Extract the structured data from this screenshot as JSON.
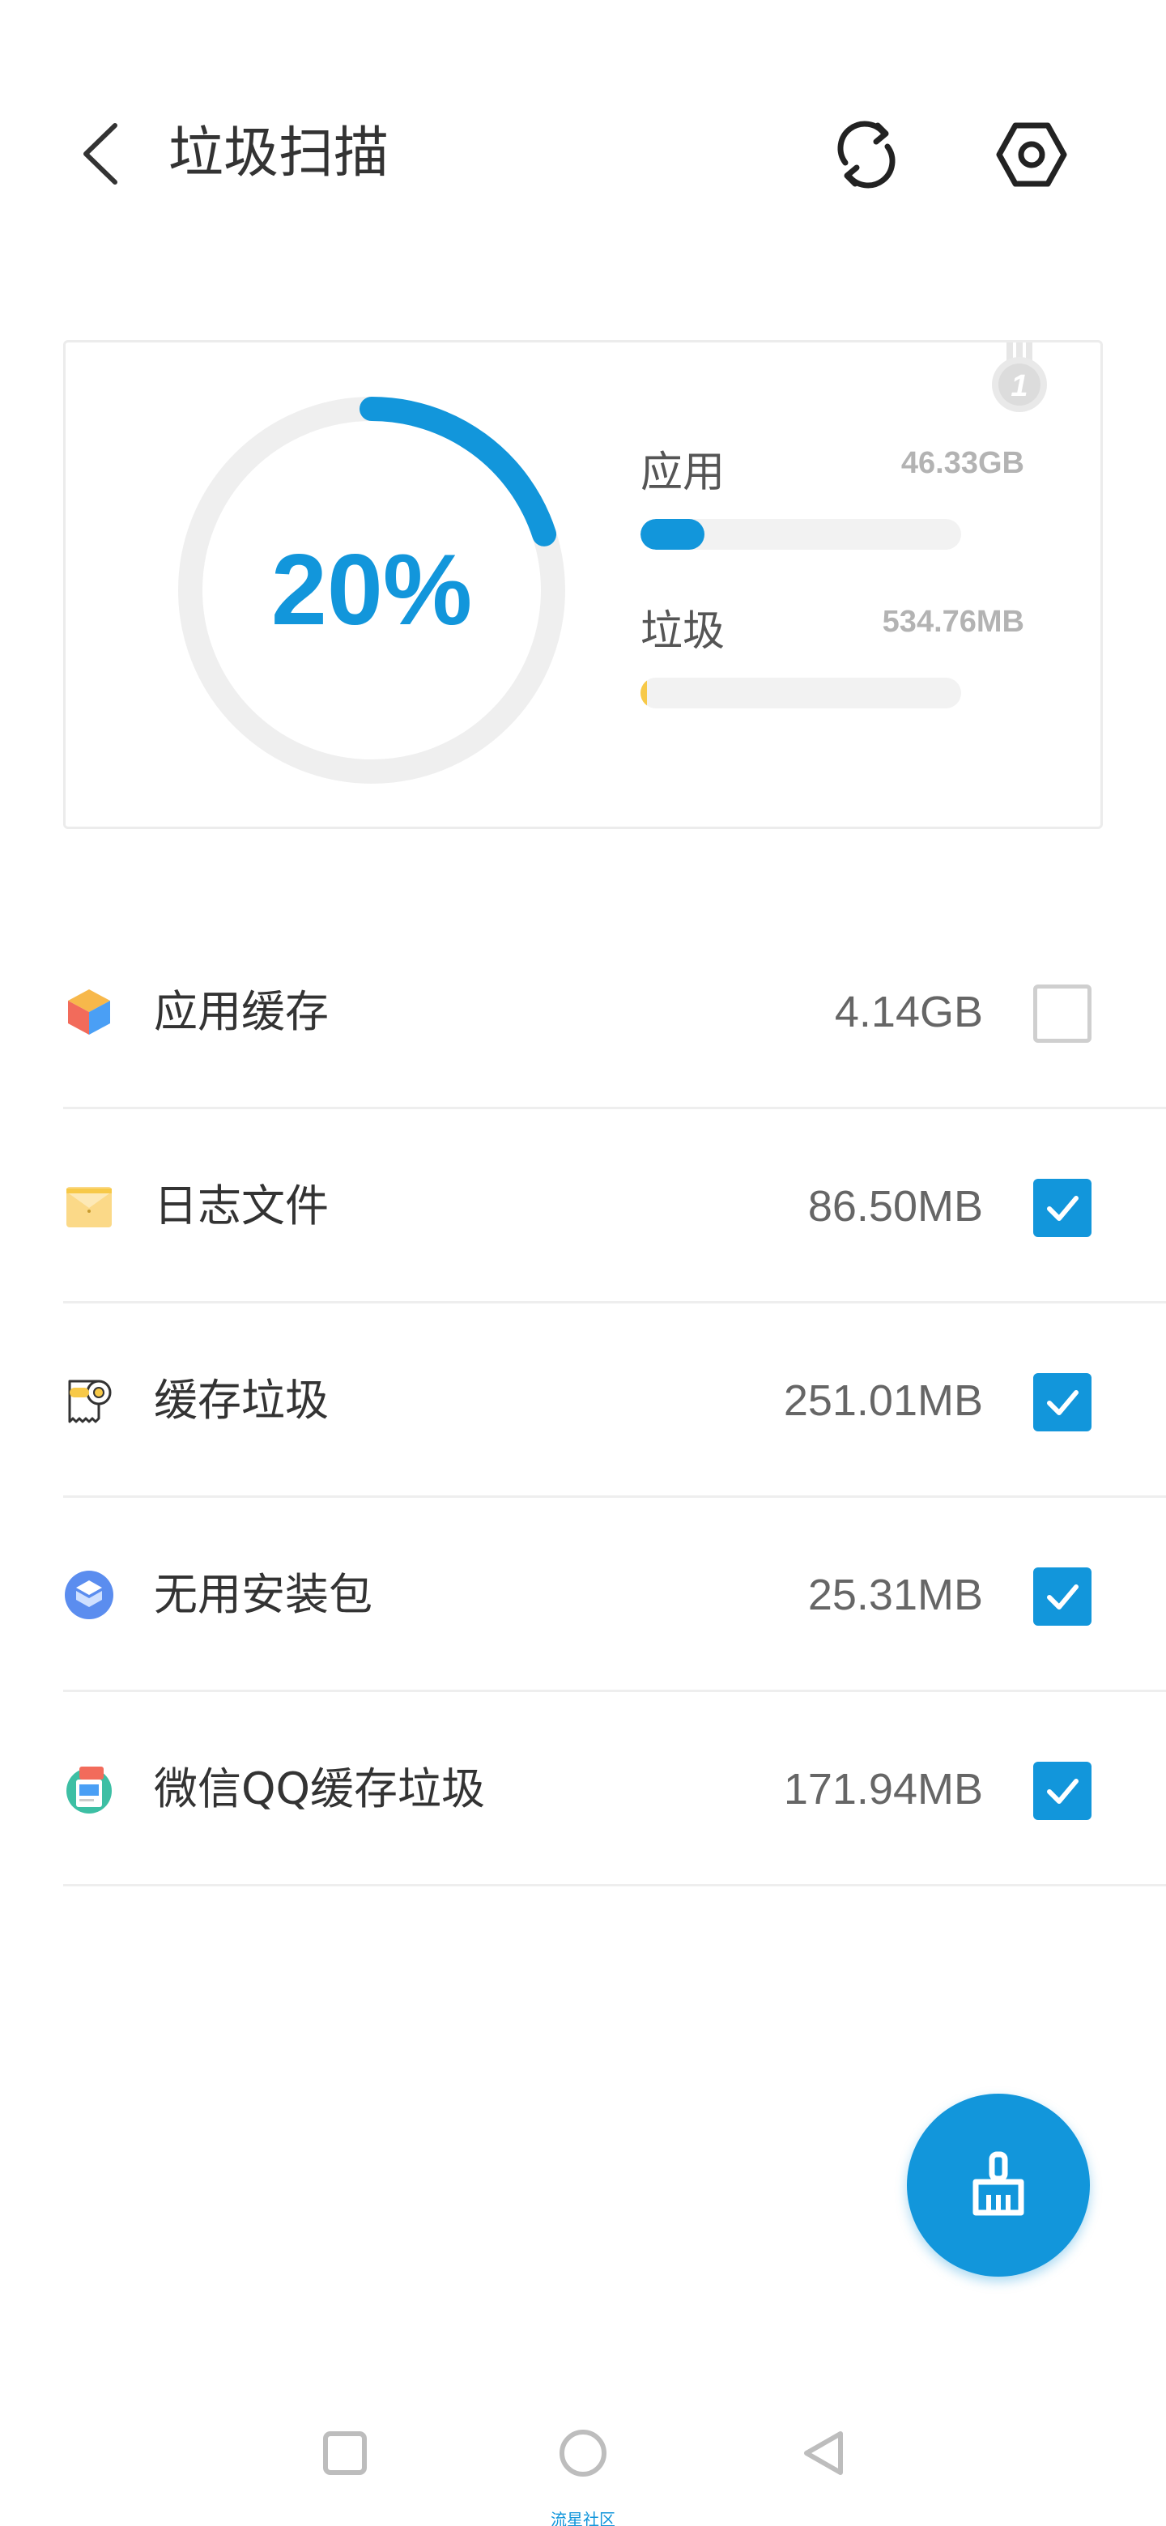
{
  "header": {
    "title": "垃圾扫描",
    "back_icon": "chevron-left-icon",
    "refresh_icon": "refresh-icon",
    "settings_icon": "hexagon-gear-icon"
  },
  "summary": {
    "percent_text": "20%",
    "ring_progress": 0.2,
    "app_label": "应用",
    "app_value": "46.33GB",
    "app_bar_fraction": 0.2,
    "junk_label": "垃圾",
    "junk_value": "534.76MB",
    "junk_bar_fraction": 0.02,
    "badge_number": "1"
  },
  "items": [
    {
      "label": "应用缓存",
      "size": "4.14GB",
      "checked": false,
      "icon": "cube-icon"
    },
    {
      "label": "日志文件",
      "size": "86.50MB",
      "checked": true,
      "icon": "envelope-icon"
    },
    {
      "label": "缓存垃圾",
      "size": "251.01MB",
      "checked": true,
      "icon": "tissue-roll-icon"
    },
    {
      "label": "无用安装包",
      "size": "25.31MB",
      "checked": true,
      "icon": "package-icon"
    },
    {
      "label": "微信QQ缓存垃圾",
      "size": "171.94MB",
      "checked": true,
      "icon": "chat-icon"
    }
  ],
  "fab_icon": "broom-icon",
  "navbar": {
    "recent_icon": "square-icon",
    "home_icon": "circle-icon",
    "back_icon": "triangle-back-icon",
    "watermark": "流星社区"
  },
  "colors": {
    "accent": "#1296db",
    "junk_bar": "#f7c948",
    "track": "#efefef"
  }
}
